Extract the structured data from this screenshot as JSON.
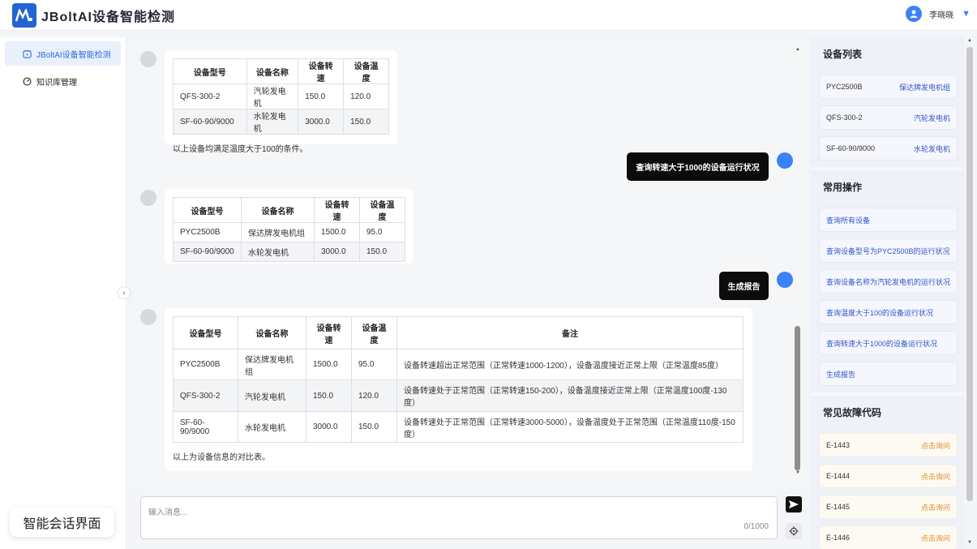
{
  "header": {
    "app_title": "JBoltAI设备智能检测",
    "user_name": "李晓晓"
  },
  "sidebar": {
    "items": [
      {
        "label": "JBoltAI设备智能检测",
        "icon": "dashboard-icon",
        "active": true
      },
      {
        "label": "知识库管理",
        "icon": "gauge-icon",
        "active": false
      }
    ],
    "footer_label": "智能会话界面"
  },
  "chat": {
    "msg1": {
      "headers": [
        "设备型号",
        "设备名称",
        "设备转速",
        "设备温度"
      ],
      "rows": [
        [
          "QFS-300-2",
          "汽轮发电机",
          "150.0",
          "120.0"
        ],
        [
          "SF-60-90/9000",
          "水轮发电机",
          "3000.0",
          "150.0"
        ]
      ],
      "note": "以上设备均满足温度大于100的条件。"
    },
    "user1": "查询转速大于1000的设备运行状况",
    "msg2": {
      "headers": [
        "设备型号",
        "设备名称",
        "设备转速",
        "设备温度"
      ],
      "rows": [
        [
          "PYC2500B",
          "保达牌发电机组",
          "1500.0",
          "95.0"
        ],
        [
          "SF-60-90/9000",
          "水轮发电机",
          "3000.0",
          "150.0"
        ]
      ]
    },
    "user2": "生成报告",
    "msg3": {
      "headers": [
        "设备型号",
        "设备名称",
        "设备转速",
        "设备温度",
        "备注"
      ],
      "rows": [
        [
          "PYC2500B",
          "保达牌发电机组",
          "1500.0",
          "95.0",
          "设备转速超出正常范围（正常转速1000-1200），设备温度接近正常上限（正常温度85度）"
        ],
        [
          "QFS-300-2",
          "汽轮发电机",
          "150.0",
          "120.0",
          "设备转速处于正常范围（正常转速150-200），设备温度接近正常上限（正常温度100度-130度）"
        ],
        [
          "SF-60-90/9000",
          "水轮发电机",
          "3000.0",
          "150.0",
          "设备转速处于正常范围（正常转速3000-5000），设备温度处于正常范围（正常温度110度-150度）"
        ]
      ],
      "note": "以上为设备信息的对比表。"
    }
  },
  "input": {
    "placeholder": "输入消息...",
    "counter": "0/1000"
  },
  "right_panel": {
    "device_list_title": "设备列表",
    "devices": [
      {
        "model": "PYC2500B",
        "name": "保达牌发电机组"
      },
      {
        "model": "QFS-300-2",
        "name": "汽轮发电机"
      },
      {
        "model": "SF-60-90/9000",
        "name": "水轮发电机"
      }
    ],
    "common_ops_title": "常用操作",
    "ops": [
      "查询所有设备",
      "查询设备型号为PYC2500B的运行状况",
      "查询设备名称为汽轮发电机的运行状况",
      "查询温度大于100的设备运行状况",
      "查询转速大于1000的设备运行状况",
      "生成报告"
    ],
    "faults_title": "常见故障代码",
    "faults": [
      {
        "code": "E-1443",
        "action": "点击询问"
      },
      {
        "code": "E-1444",
        "action": "点击询问"
      },
      {
        "code": "E-1445",
        "action": "点击询问"
      },
      {
        "code": "E-1446",
        "action": "点击询问"
      }
    ]
  },
  "colors": {
    "brand": "#2364d2",
    "accent": "#3b82f6",
    "user_bubble": "#0c0c0c",
    "fault_action": "#e08a1e"
  }
}
